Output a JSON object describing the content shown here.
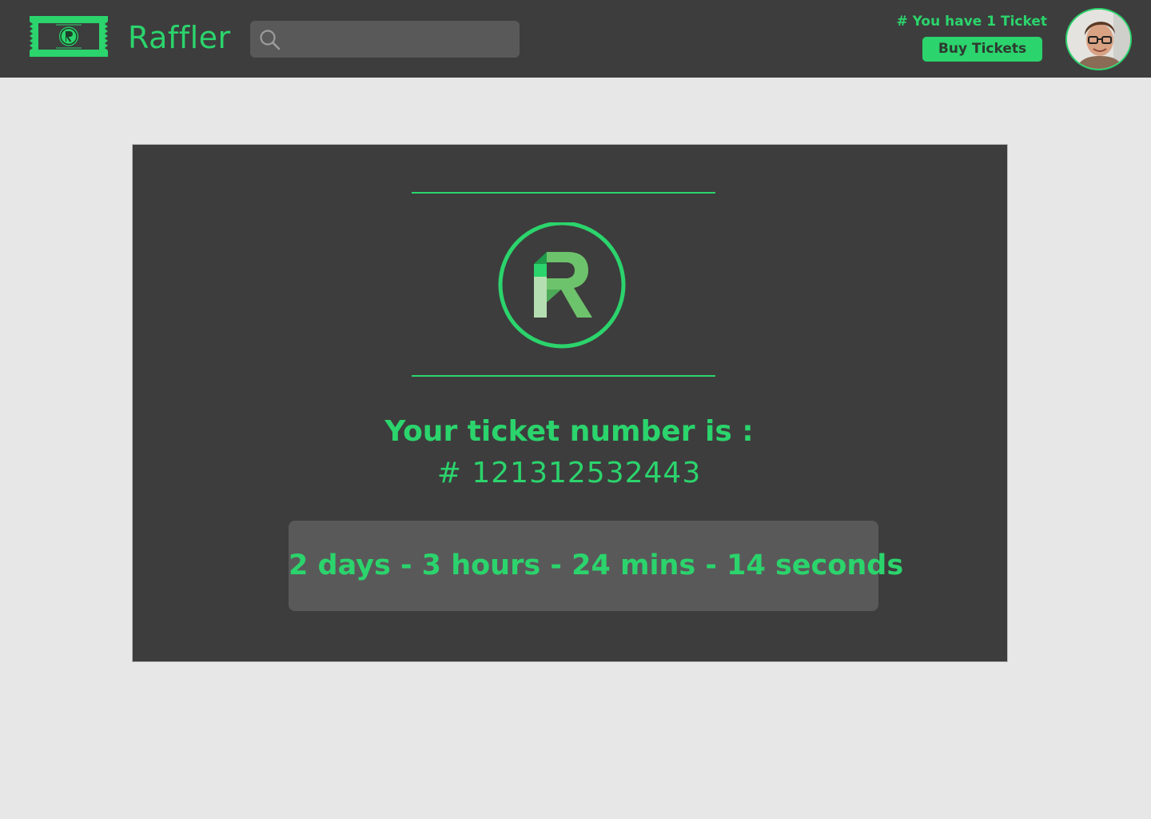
{
  "header": {
    "brand": "Raffler",
    "search_placeholder": "",
    "tickets_owned": "# You have 1 Ticket",
    "buy_label": "Buy Tickets"
  },
  "main": {
    "ticket_label": "Your ticket number is :",
    "ticket_number": "# 121312532443",
    "countdown": "2 days - 3 hours - 24 mins - 14 seconds"
  },
  "icons": {
    "logo": "ticket-logo-icon",
    "search": "search-icon",
    "emblem": "raffler-emblem-icon",
    "avatar": "user-avatar"
  },
  "colors": {
    "accent": "#2bd46c",
    "topbar": "#3d3d3d",
    "card": "#3d3d3d",
    "page_bg": "#e7e7e7",
    "field_bg": "#5a595a"
  }
}
